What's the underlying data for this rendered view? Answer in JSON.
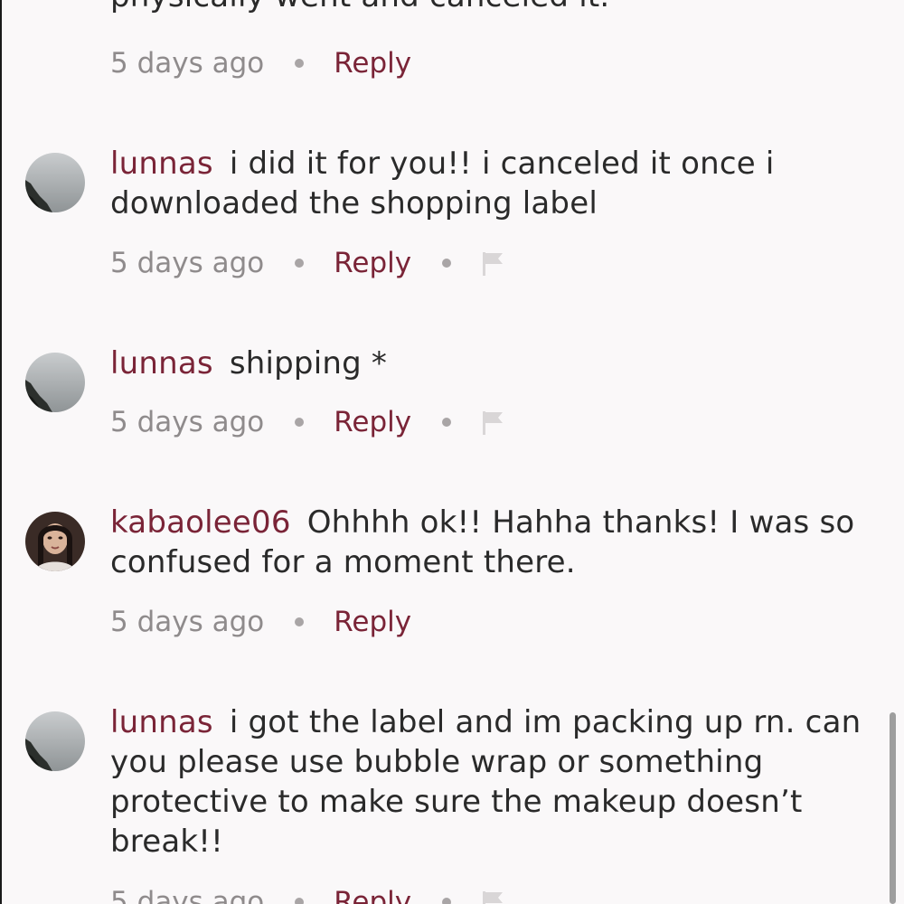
{
  "comments": [
    {
      "text": "physically went and canceled it.",
      "time": "5 days ago",
      "reply_label": "Reply"
    },
    {
      "username": "lunnas",
      "text": "i did it for you!! i canceled it once i downloaded the shopping label",
      "time": "5 days ago",
      "reply_label": "Reply"
    },
    {
      "username": "lunnas",
      "text": "shipping *",
      "time": "5 days ago",
      "reply_label": "Reply"
    },
    {
      "username": "kabaolee06",
      "text": "Ohhhh ok!! Hahha thanks! I was so confused for a moment there.",
      "time": "5 days ago",
      "reply_label": "Reply"
    },
    {
      "username": "lunnas",
      "text": "i got the label and im packing up rn. can you please use bubble wrap or something protective to make sure the makeup doesn’t break!!",
      "time": "5 days ago",
      "reply_label": "Reply"
    }
  ],
  "colors": {
    "accent": "#7a2437",
    "muted_text": "#8f8b8c",
    "body_text": "#2a2a2a",
    "background": "#faf8f9"
  },
  "icons": [
    "flag-icon"
  ]
}
